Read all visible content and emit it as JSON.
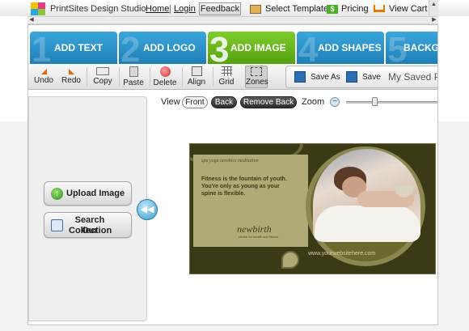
{
  "topbar": {
    "brand": "PrintSites Design Studio",
    "home_label": "Home",
    "separator": "|",
    "login_label": "Login",
    "feedback_label": "Feedback",
    "select_template_label": "Select Template",
    "pricing_label": "Pricing",
    "view_cart_label": "View Cart"
  },
  "tabs": [
    {
      "num": "1",
      "label": "ADD TEXT",
      "color": "#2a8fc7"
    },
    {
      "num": "2",
      "label": "ADD LOGO",
      "color": "#2a8fc7"
    },
    {
      "num": "3",
      "label": "ADD IMAGE",
      "color": "#69b51e"
    },
    {
      "num": "4",
      "label": "ADD SHAPES",
      "color": "#2a8fc7"
    },
    {
      "num": "5",
      "label": "BACKGR",
      "color": "#2a8fc7"
    }
  ],
  "toolbar": {
    "undo": "Undo",
    "redo": "Redo",
    "copy": "Copy",
    "paste": "Paste",
    "delete": "Delete",
    "align": "Align",
    "grid": "Grid",
    "zones": "Zones",
    "save_as": "Save As",
    "save": "Save",
    "my_saved": "My Saved Pro"
  },
  "side": {
    "upload_label": "Upload Image",
    "search_label_1": "Search Our",
    "search_label_2": "Collection",
    "collapse_glyph": "◀◀"
  },
  "view": {
    "label": "View",
    "front": "Front",
    "back": "Back",
    "remove_back": "Remove Back",
    "zoom_label": "Zoom",
    "zoom_minus": "−",
    "zoom_level": 0.3
  },
  "card": {
    "tagline": "spa  yoga  aerobics  meditation",
    "msg_line1": "Fitness is the  fountain of youth.",
    "msg_line2": "You're only as young as your",
    "msg_line3": "spine is flexible.",
    "brand_name": "newbirth",
    "brand_sub": "centre for health and fitness",
    "url": "www.yourwebsitehere.com"
  },
  "colors": {
    "tab_blue": "#2a8fc7",
    "tab_green": "#69b51e",
    "card_dark": "#3a3a16",
    "card_green": "#b0aa77"
  }
}
